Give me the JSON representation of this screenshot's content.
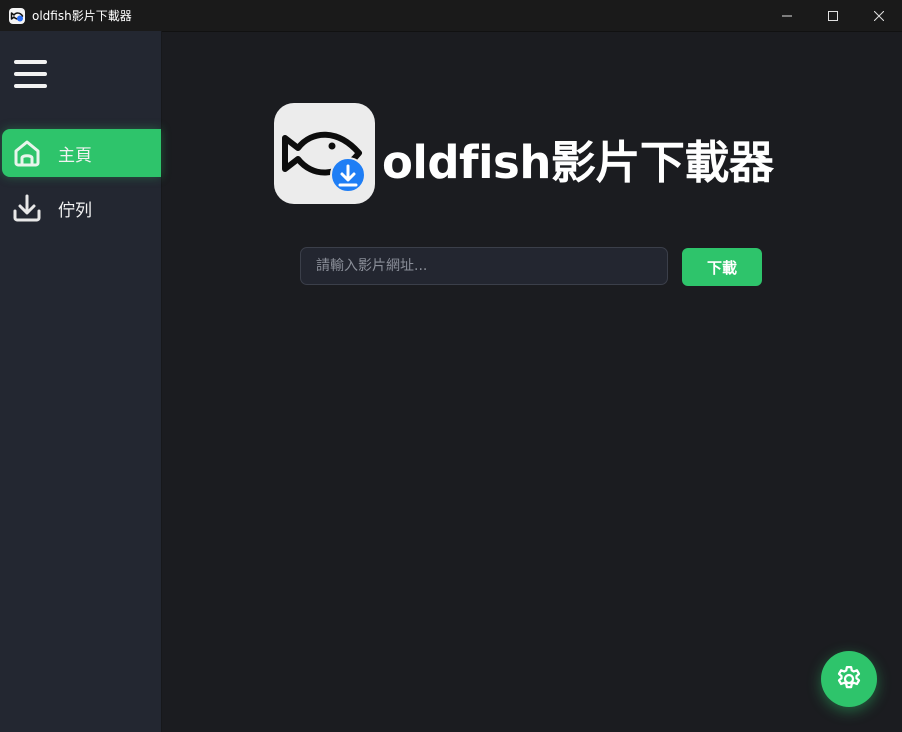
{
  "window": {
    "title": "oldfish影片下載器",
    "controls": [
      "minimize-icon",
      "maximize-icon",
      "close-icon"
    ]
  },
  "sidebar": {
    "menu_icon": "hamburger-icon",
    "items": [
      {
        "label": "主頁",
        "icon": "home-icon",
        "active": true
      },
      {
        "label": "佇列",
        "icon": "download-icon",
        "active": false
      }
    ]
  },
  "main": {
    "logo_icon": "fish-download-logo",
    "app_name": "oldfish影片下載器",
    "url_input": {
      "placeholder": "請輸入影片網址...",
      "value": ""
    },
    "download_label": "下載",
    "settings_icon": "gear-icon"
  },
  "colors": {
    "accent": "#2ec46b",
    "background": "#1b1c20",
    "sidebar": "#232731",
    "titlebar": "#1a1a1a"
  }
}
